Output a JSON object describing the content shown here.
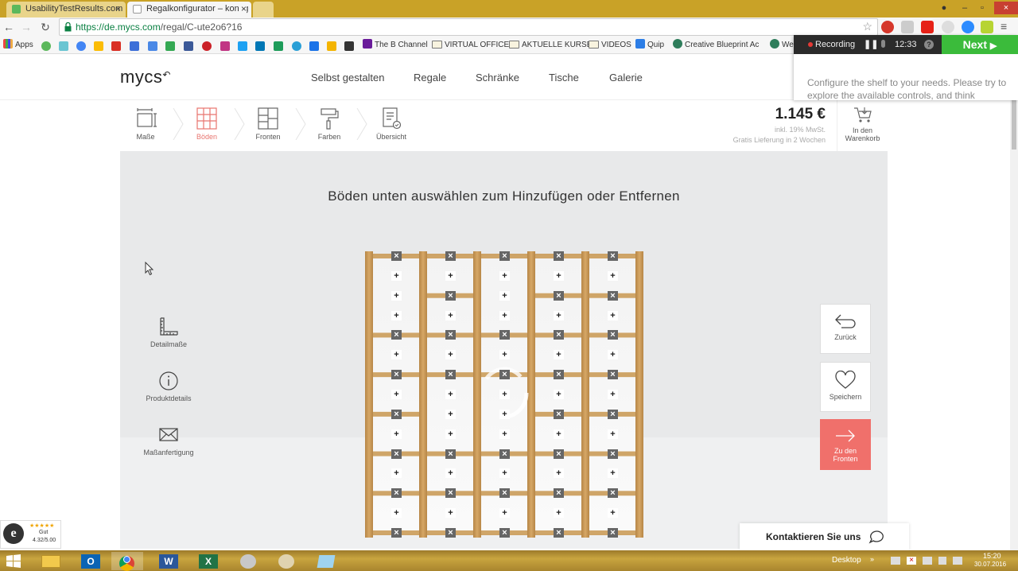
{
  "browser": {
    "tabs": [
      {
        "title": "UsabilityTestResults.com",
        "active": false
      },
      {
        "title": "Regalkonfigurator – konfig",
        "active": true
      }
    ],
    "url_domain": "https://de.mycs.com",
    "url_path": "/regal/C-ute2o6?16",
    "bookmarks": [
      "Apps",
      "The B Channel",
      "VIRTUAL OFFICE",
      "AKTUELLE KURSE",
      "VIDEOS",
      "Quip",
      "Creative Blueprint Ac",
      "We"
    ]
  },
  "recorder": {
    "status": "Recording",
    "time": "12:33",
    "next_label": "Next",
    "instruction": "Configure the shelf to your needs. Please try to explore the available controls, and think"
  },
  "site": {
    "logo": "mycs",
    "nav": [
      "Selbst gestalten",
      "Regale",
      "Schränke",
      "Tische",
      "Galerie"
    ],
    "steps": [
      {
        "label": "Maße",
        "icon": "dimensions-icon",
        "active": false
      },
      {
        "label": "Böden",
        "icon": "shelves-icon",
        "active": true
      },
      {
        "label": "Fronten",
        "icon": "fronts-icon",
        "active": false
      },
      {
        "label": "Farben",
        "icon": "paint-roller-icon",
        "active": false
      },
      {
        "label": "Übersicht",
        "icon": "overview-icon",
        "active": false
      }
    ],
    "price": "1.145 €",
    "price_tax": "inkl. 19% MwSt.",
    "delivery": "Gratis Lieferung in 2 Wochen",
    "cart_label_1": "In den",
    "cart_label_2": "Warenkorb",
    "stage_title": "Böden unten auswählen zum Hinzufügen oder Entfernen",
    "side_tools": [
      "Detailmaße",
      "Produktdetails",
      "Maßanfertigung"
    ],
    "right_actions": [
      {
        "label": "Zurück",
        "icon": "undo-arrow-icon"
      },
      {
        "label": "Speichern",
        "icon": "heart-icon"
      },
      {
        "label_1": "Zu den",
        "label_2": "Fronten",
        "icon": "arrow-right-icon"
      }
    ],
    "contact": "Kontaktieren Sie uns",
    "rating_text": "Gut",
    "rating_score": "4.32/5.00"
  },
  "shelf": {
    "columns": 5,
    "levels": 15,
    "markers": [
      [
        "rm",
        "rm",
        "rm",
        "rm",
        "rm"
      ],
      [
        "add",
        "add",
        "add",
        "add",
        "add"
      ],
      [
        "add",
        "rm",
        "add",
        "rm",
        "rm"
      ],
      [
        "add",
        "add",
        "add",
        "add",
        "add"
      ],
      [
        "rm",
        "rm",
        "rm",
        "rm",
        "rm"
      ],
      [
        "add",
        "add",
        "add",
        "add",
        "add"
      ],
      [
        "rm",
        "rm",
        "rm",
        "rm",
        "rm"
      ],
      [
        "add",
        "add",
        "add",
        "add",
        "add"
      ],
      [
        "rm",
        "add",
        "add",
        "rm",
        "rm"
      ],
      [
        "add",
        "add",
        "add",
        "add",
        "add"
      ],
      [
        "rm",
        "rm",
        "rm",
        "rm",
        "rm"
      ],
      [
        "add",
        "add",
        "add",
        "add",
        "add"
      ],
      [
        "rm",
        "rm",
        "rm",
        "rm",
        "rm"
      ],
      [
        "add",
        "add",
        "add",
        "add",
        "add"
      ],
      [
        "rm",
        "rm",
        "rm",
        "rm",
        "rm"
      ]
    ]
  },
  "taskbar": {
    "desktop_label": "Desktop",
    "time": "15:20",
    "date": "30.07.2016"
  },
  "colors": {
    "accent": "#f0706b",
    "next_green": "#3bbb3b",
    "wood": "#c8974f"
  }
}
